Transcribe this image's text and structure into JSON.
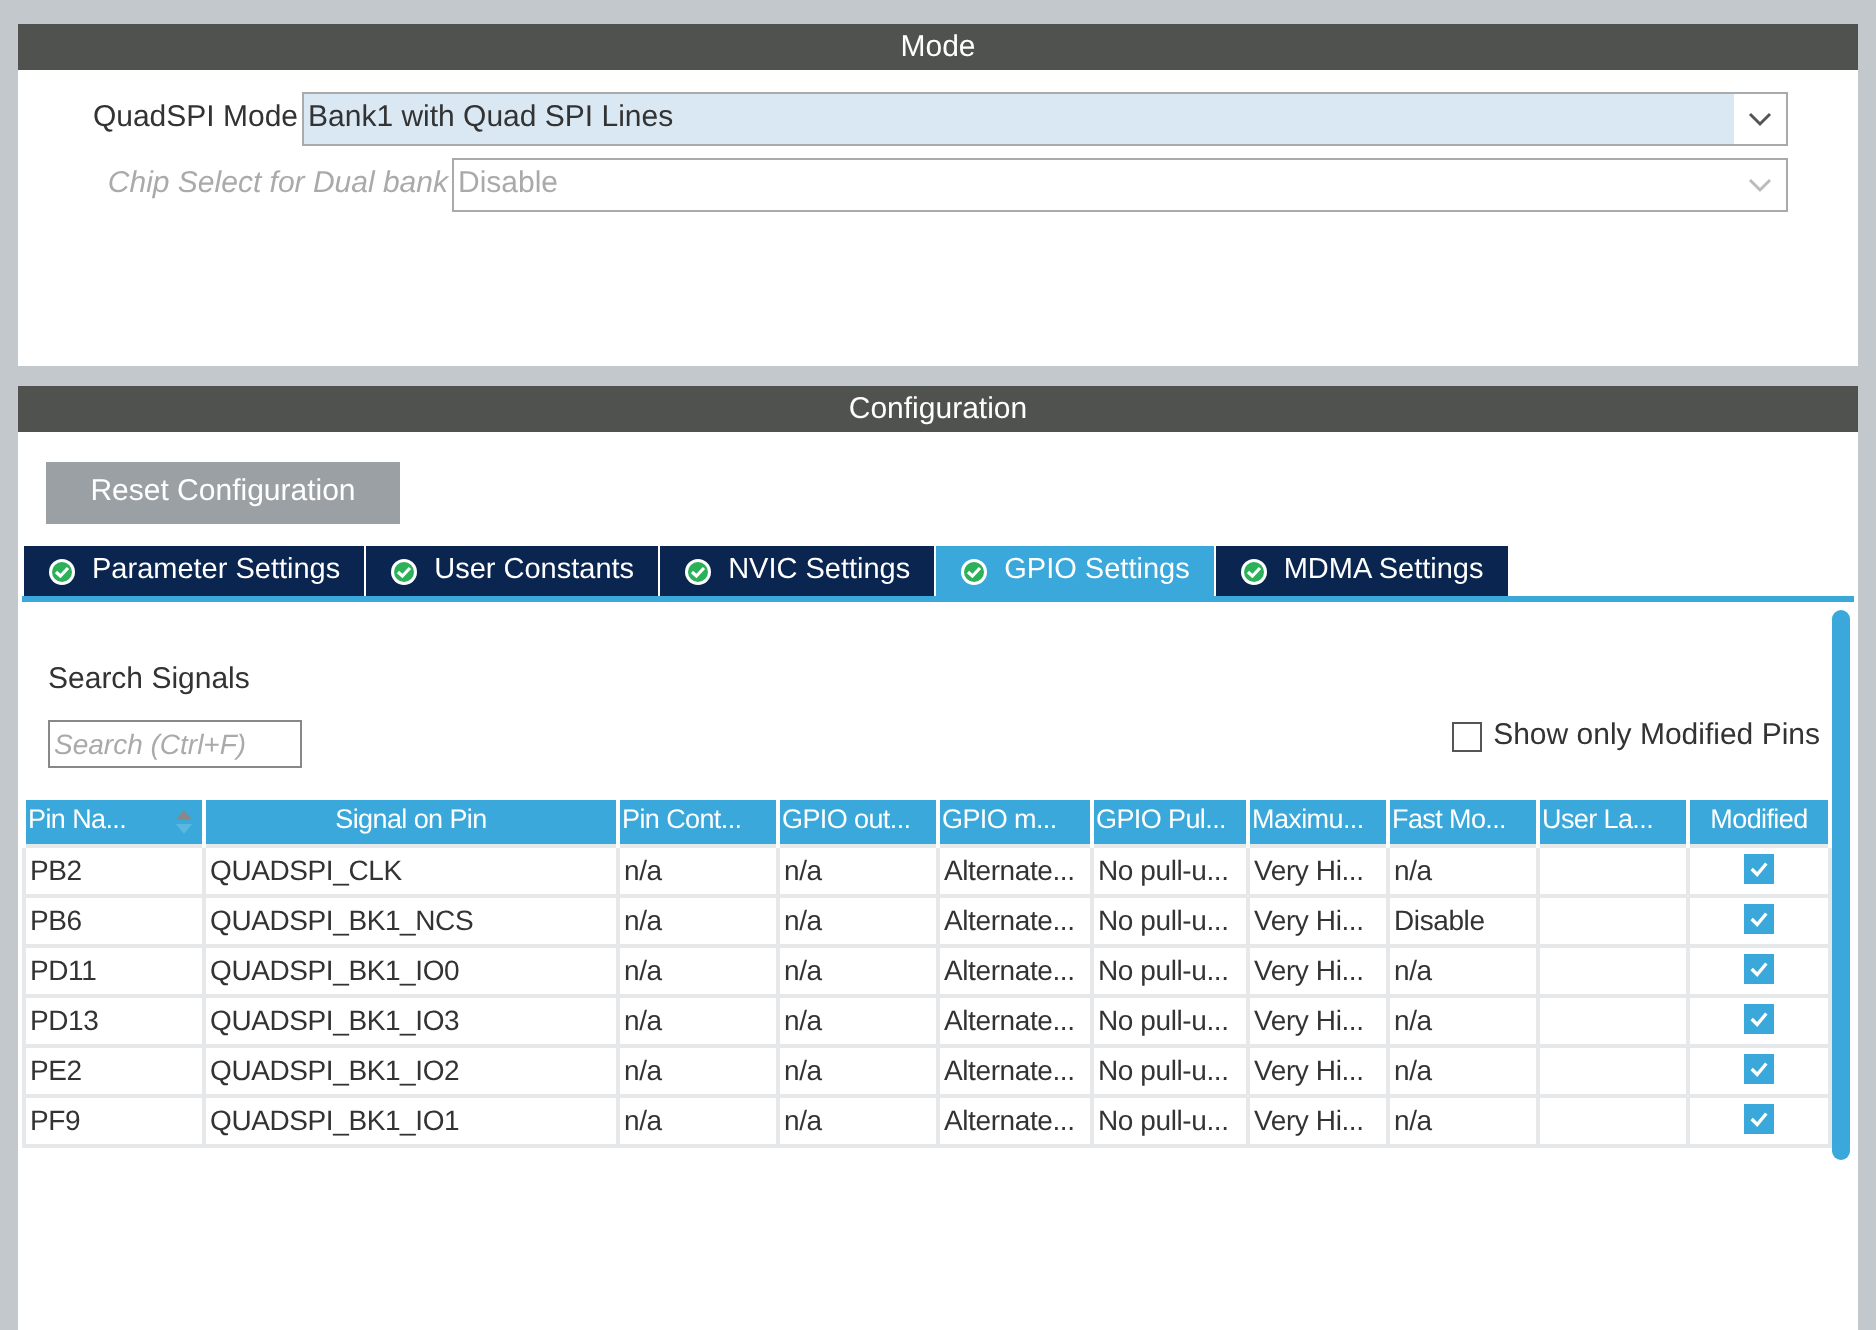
{
  "mode_header": "Mode",
  "mode_fields": [
    {
      "label": "QuadSPI Mode",
      "value": "Bank1 with Quad SPI Lines",
      "disabled": false
    },
    {
      "label": "Chip Select for Dual bank",
      "value": "Disable",
      "disabled": true
    }
  ],
  "config_header": "Configuration",
  "reset_button": "Reset Configuration",
  "tabs": [
    {
      "label": "Parameter Settings",
      "selected": false
    },
    {
      "label": "User Constants",
      "selected": false
    },
    {
      "label": "NVIC Settings",
      "selected": false
    },
    {
      "label": "GPIO Settings",
      "selected": true
    },
    {
      "label": "MDMA Settings",
      "selected": false
    }
  ],
  "search": {
    "label": "Search Signals",
    "placeholder": "Search (Ctrl+F)"
  },
  "show_modified": {
    "label": "Show only Modified Pins",
    "checked": false
  },
  "table": {
    "columns": [
      "Pin Na...",
      "Signal on Pin",
      "Pin Cont...",
      "GPIO out...",
      "GPIO m...",
      "GPIO Pul...",
      "Maximu...",
      "Fast Mo...",
      "User La...",
      "Modified"
    ],
    "rows": [
      {
        "cells": [
          "PB2",
          "QUADSPI_CLK",
          "n/a",
          "n/a",
          "Alternate...",
          "No pull-u...",
          "Very Hi...",
          "n/a",
          ""
        ],
        "modified": true
      },
      {
        "cells": [
          "PB6",
          "QUADSPI_BK1_NCS",
          "n/a",
          "n/a",
          "Alternate...",
          "No pull-u...",
          "Very Hi...",
          "Disable",
          ""
        ],
        "modified": true
      },
      {
        "cells": [
          "PD11",
          "QUADSPI_BK1_IO0",
          "n/a",
          "n/a",
          "Alternate...",
          "No pull-u...",
          "Very Hi...",
          "n/a",
          ""
        ],
        "modified": true
      },
      {
        "cells": [
          "PD13",
          "QUADSPI_BK1_IO3",
          "n/a",
          "n/a",
          "Alternate...",
          "No pull-u...",
          "Very Hi...",
          "n/a",
          ""
        ],
        "modified": true
      },
      {
        "cells": [
          "PE2",
          "QUADSPI_BK1_IO2",
          "n/a",
          "n/a",
          "Alternate...",
          "No pull-u...",
          "Very Hi...",
          "n/a",
          ""
        ],
        "modified": true
      },
      {
        "cells": [
          "PF9",
          "QUADSPI_BK1_IO1",
          "n/a",
          "n/a",
          "Alternate...",
          "No pull-u...",
          "Very Hi...",
          "n/a",
          ""
        ],
        "modified": true
      }
    ]
  }
}
